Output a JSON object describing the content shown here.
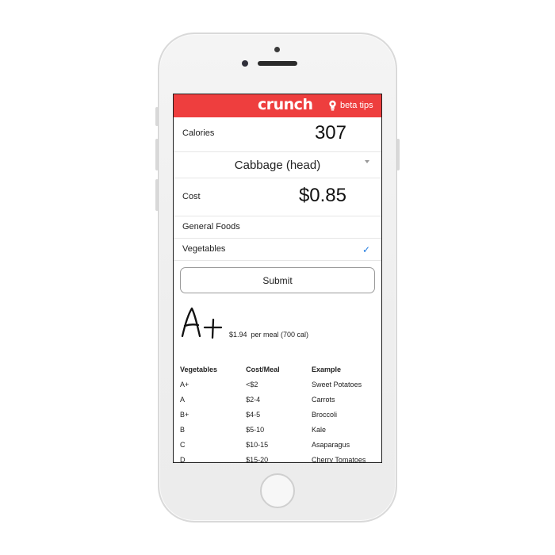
{
  "app": {
    "logo": "crunch",
    "tips_label": "beta tips"
  },
  "calories": {
    "label": "Calories",
    "value": "307"
  },
  "food_select": {
    "value": "Cabbage (head)"
  },
  "cost": {
    "label": "Cost",
    "value": "$0.85"
  },
  "categories": [
    {
      "label": "General Foods",
      "checked": false
    },
    {
      "label": "Vegetables",
      "checked": true
    }
  ],
  "checkmark": "✓",
  "submit_label": "Submit",
  "result": {
    "grade": "A+",
    "detail": "$1.94  per meal (700 cal)"
  },
  "grade_table": {
    "headers": [
      "Vegetables",
      "Cost/Meal",
      "Example"
    ],
    "rows": [
      [
        "A+",
        "<$2",
        "Sweet Potatoes"
      ],
      [
        "A",
        "$2-4",
        "Carrots"
      ],
      [
        "B+",
        "$4-5",
        "Broccoli"
      ],
      [
        "B",
        "$5-10",
        "Kale"
      ],
      [
        "C",
        "$10-15",
        "Asaparagus"
      ],
      [
        "D",
        "$15-20",
        "Cherry Tomatoes"
      ]
    ]
  },
  "colors": {
    "brand": "#ee3e3e",
    "check": "#1f7ae0"
  }
}
